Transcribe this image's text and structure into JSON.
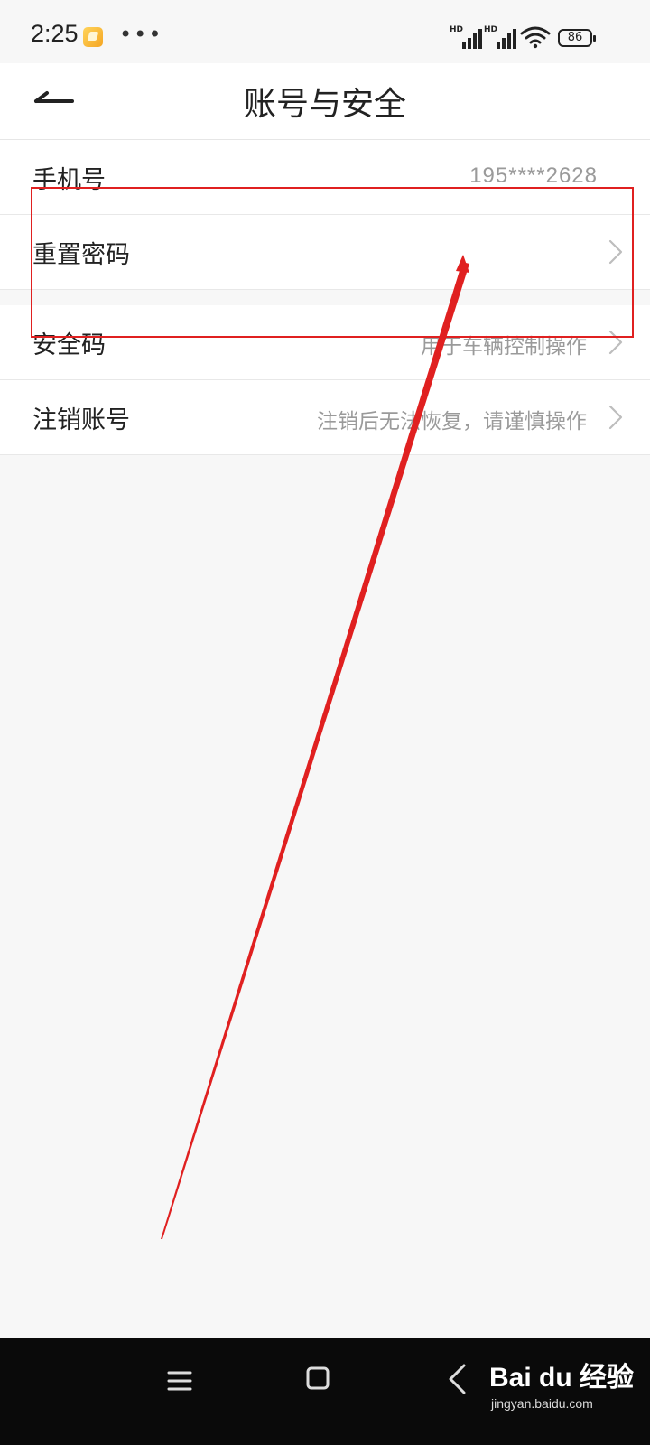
{
  "status_bar": {
    "time": "2:25",
    "battery": "86",
    "signal_1": "HD",
    "signal_2": "HD",
    "icons": [
      "notification-app-icon",
      "more-dots-icon",
      "signal-icon",
      "signal-icon",
      "wifi-icon",
      "battery-icon"
    ]
  },
  "header": {
    "title": "账号与安全",
    "back_icon": "back-arrow-icon"
  },
  "account_rows": [
    {
      "label": "手机号",
      "value": "195****2628",
      "has_chevron": false
    },
    {
      "label": "重置密码",
      "value": "",
      "has_chevron": true
    }
  ],
  "security_rows": [
    {
      "label": "安全码",
      "value": "用于车辆控制操作",
      "has_chevron": true
    },
    {
      "label": "注销账号",
      "value": "注销后无法恢复，请谨慎操作",
      "has_chevron": true
    }
  ],
  "annotation": {
    "color": "#e02020",
    "target": "重置密码"
  },
  "nav_bar": {
    "icons": [
      "menu-icon",
      "home-icon",
      "back-icon"
    ]
  },
  "watermark": {
    "logo": "Bai du 经验",
    "url": "jingyan.baidu.com"
  }
}
